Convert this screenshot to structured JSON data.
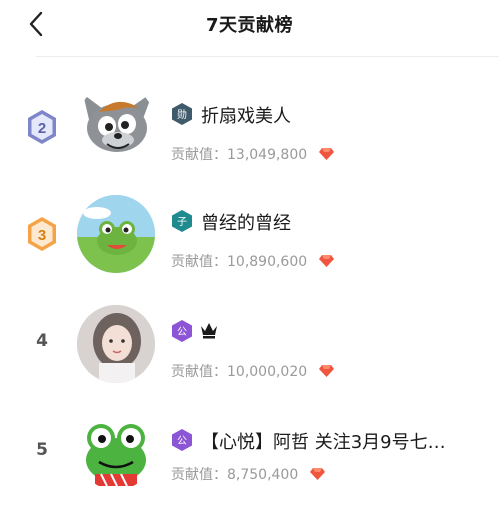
{
  "header": {
    "title": "7天贡献榜",
    "back_icon": "chevron-left-icon"
  },
  "colors": {
    "gem": "#f0563f",
    "rank2_badge": "#7e86c9",
    "rank3_badge": "#f4a446",
    "level_dark": "#3f5a6b",
    "level_teal": "#1f8b8f",
    "level_purple": "#8c55d6"
  },
  "score_label": "贡献值：",
  "rows": [
    {
      "rank": "2",
      "name": "折扇戏美人",
      "score": "13,049,800",
      "level_icon": "shield-level-icon",
      "level_text": "勋"
    },
    {
      "rank": "3",
      "name": "曾经的曾经",
      "score": "10,890,600",
      "level_icon": "shield-level-icon",
      "level_text": "子"
    },
    {
      "rank": "4",
      "name": "",
      "score": "10,000,020",
      "level_icon": "shield-level-icon",
      "level_text": "公",
      "extra_icon": "crown-icon"
    },
    {
      "rank": "5",
      "name": "【心悦】阿哲 关注3月9号七…",
      "score": "8,750,400",
      "level_icon": "shield-level-icon",
      "level_text": "公"
    }
  ]
}
